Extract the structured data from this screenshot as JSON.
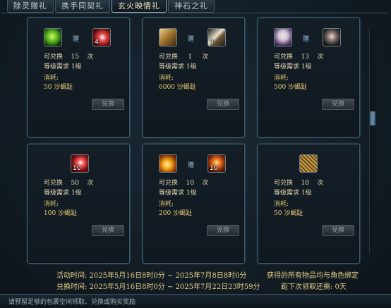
{
  "tabs": [
    {
      "label": "除灵赠礼",
      "active": false
    },
    {
      "label": "携手同契礼",
      "active": false
    },
    {
      "label": "玄火映情礼",
      "active": true
    },
    {
      "label": "神石之礼",
      "active": false
    }
  ],
  "gift_label": "赠",
  "cards": [
    {
      "left_icon": "green-orb-icon",
      "right_icon": "red-rune-icon",
      "right_count": "4",
      "exchange_label": "可兑换",
      "exchange_count": "15",
      "unit": "次",
      "level_text": "等级需求 1级",
      "cost_label": "消耗:",
      "cost_value": "50 沙蝎趾",
      "button": "兑换"
    },
    {
      "left_icon": "book-icon",
      "right_icon": "scroll-icon",
      "right_count": "3",
      "exchange_label": "可兑换",
      "exchange_count": "1",
      "unit": "次",
      "level_text": "等级需求 1级",
      "cost_label": "消耗:",
      "cost_value": "6000 沙蝎趾",
      "button": "兑换"
    },
    {
      "left_icon": "white-hair-avatar-icon",
      "right_icon": "dark-hair-avatar-icon",
      "right_count": "",
      "exchange_label": "可兑换",
      "exchange_count": "13",
      "unit": "次",
      "level_text": "等级需求 1级",
      "cost_label": "消耗:",
      "cost_value": "500 沙蝎趾",
      "button": "兑换"
    },
    {
      "left_icon": "red-crystal-icon",
      "right_icon": "",
      "left_count": "10",
      "exchange_label": "可兑换",
      "exchange_count": "50",
      "unit": "次",
      "level_text": "等级需求 1级",
      "cost_label": "消耗:",
      "cost_value": "100 沙蝎趾",
      "button": "兑换"
    },
    {
      "left_icon": "golden-flame-icon",
      "right_icon": "fire-chest-icon",
      "right_count": "10",
      "exchange_label": "可兑换",
      "exchange_count": "10",
      "unit": "次",
      "level_text": "等级需求 1级",
      "cost_label": "消耗:",
      "cost_value": "200 沙蝎趾",
      "button": "兑换"
    },
    {
      "left_icon": "",
      "right_icon": "golden-plate-icon",
      "right_count": "",
      "exchange_label": "可兑换",
      "exchange_count": "10",
      "unit": "次",
      "level_text": "等级需求 1级",
      "cost_label": "消耗:",
      "cost_value": "50 沙蝎趾",
      "button": "兑换"
    }
  ],
  "info": {
    "activity_time": "活动时间: 2025年5月16日8时0分 ~ 2025年7月8日8时0分",
    "exchange_time": "兑换时间: 2025年5月16日8时0分 ~ 2025年7月22日23时59分",
    "bind_note": "获得的所有物品均与角色绑定",
    "next_claim": "距下次领取还需: 0天"
  },
  "footer": "请预留足够的包裹空间领取、兑换或购买奖励"
}
